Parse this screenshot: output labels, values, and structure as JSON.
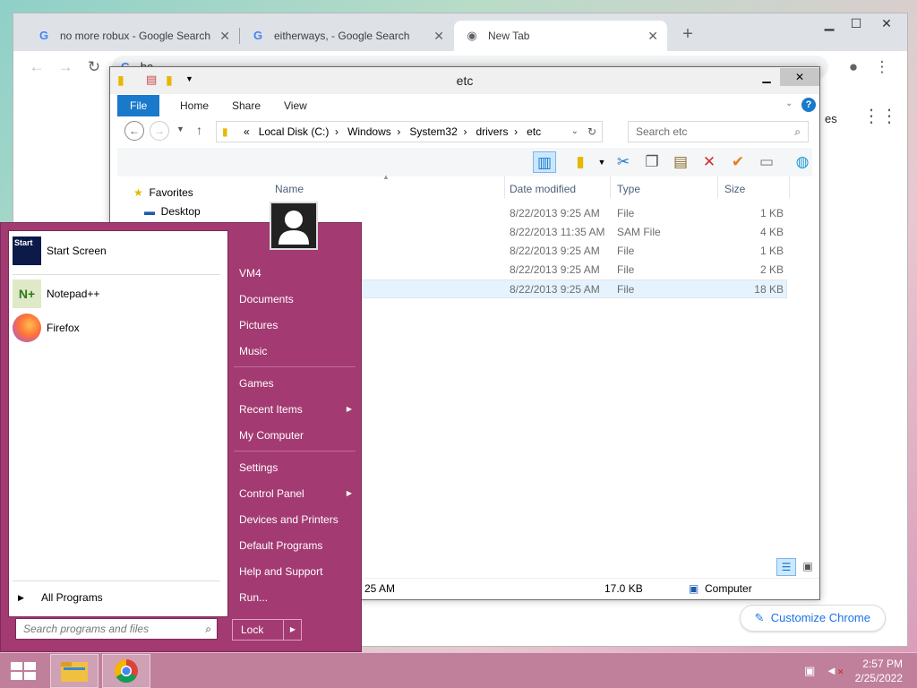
{
  "chrome": {
    "tabs": [
      {
        "label": "no more robux - Google Search",
        "active": false
      },
      {
        "label": "eitherways, - Google Search",
        "active": false
      },
      {
        "label": "New Tab",
        "active": true
      }
    ],
    "omnibox_value": "bo",
    "customize_label": "Customize Chrome",
    "apps_partial_label": "es"
  },
  "explorer": {
    "title": "etc",
    "ribbon_tabs": [
      "File",
      "Home",
      "Share",
      "View"
    ],
    "breadcrumb": [
      "«",
      "Local Disk (C:)",
      "Windows",
      "System32",
      "drivers",
      "etc"
    ],
    "search_placeholder": "Search etc",
    "nav": {
      "favorites": "Favorites",
      "desktop": "Desktop"
    },
    "columns": {
      "name": "Name",
      "date": "Date modified",
      "type": "Type",
      "size": "Size"
    },
    "files": [
      {
        "date": "8/22/2013 9:25 AM",
        "type": "File",
        "size": "1 KB"
      },
      {
        "date": "8/22/2013 11:35 AM",
        "type": "SAM File",
        "size": "4 KB"
      },
      {
        "date": "8/22/2013 9:25 AM",
        "type": "File",
        "size": "1 KB"
      },
      {
        "date": "8/22/2013 9:25 AM",
        "type": "File",
        "size": "2 KB"
      },
      {
        "date": "8/22/2013 9:25 AM",
        "type": "File",
        "size": "18 KB"
      }
    ],
    "status": {
      "modified_partial": "25 AM",
      "size": "17.0 KB",
      "location": "Computer"
    }
  },
  "startmenu": {
    "pinned": [
      {
        "label": "Start Screen",
        "icon": "start-screen-icon"
      },
      {
        "label": "Notepad++",
        "icon": "notepadpp-icon"
      },
      {
        "label": "Firefox",
        "icon": "firefox-icon"
      }
    ],
    "all_programs": "All Programs",
    "search_placeholder": "Search programs and files",
    "right_items": [
      {
        "label": "VM4"
      },
      {
        "label": "Documents"
      },
      {
        "label": "Pictures"
      },
      {
        "label": "Music"
      },
      {
        "label": "Games"
      },
      {
        "label": "Recent Items",
        "submenu": true
      },
      {
        "label": "My Computer"
      },
      {
        "label": "Settings"
      },
      {
        "label": "Control Panel",
        "submenu": true
      },
      {
        "label": "Devices and Printers"
      },
      {
        "label": "Default Programs"
      },
      {
        "label": "Help and Support"
      },
      {
        "label": "Run..."
      }
    ],
    "lock_label": "Lock"
  },
  "taskbar": {
    "time": "2:57 PM",
    "date": "2/25/2022"
  }
}
